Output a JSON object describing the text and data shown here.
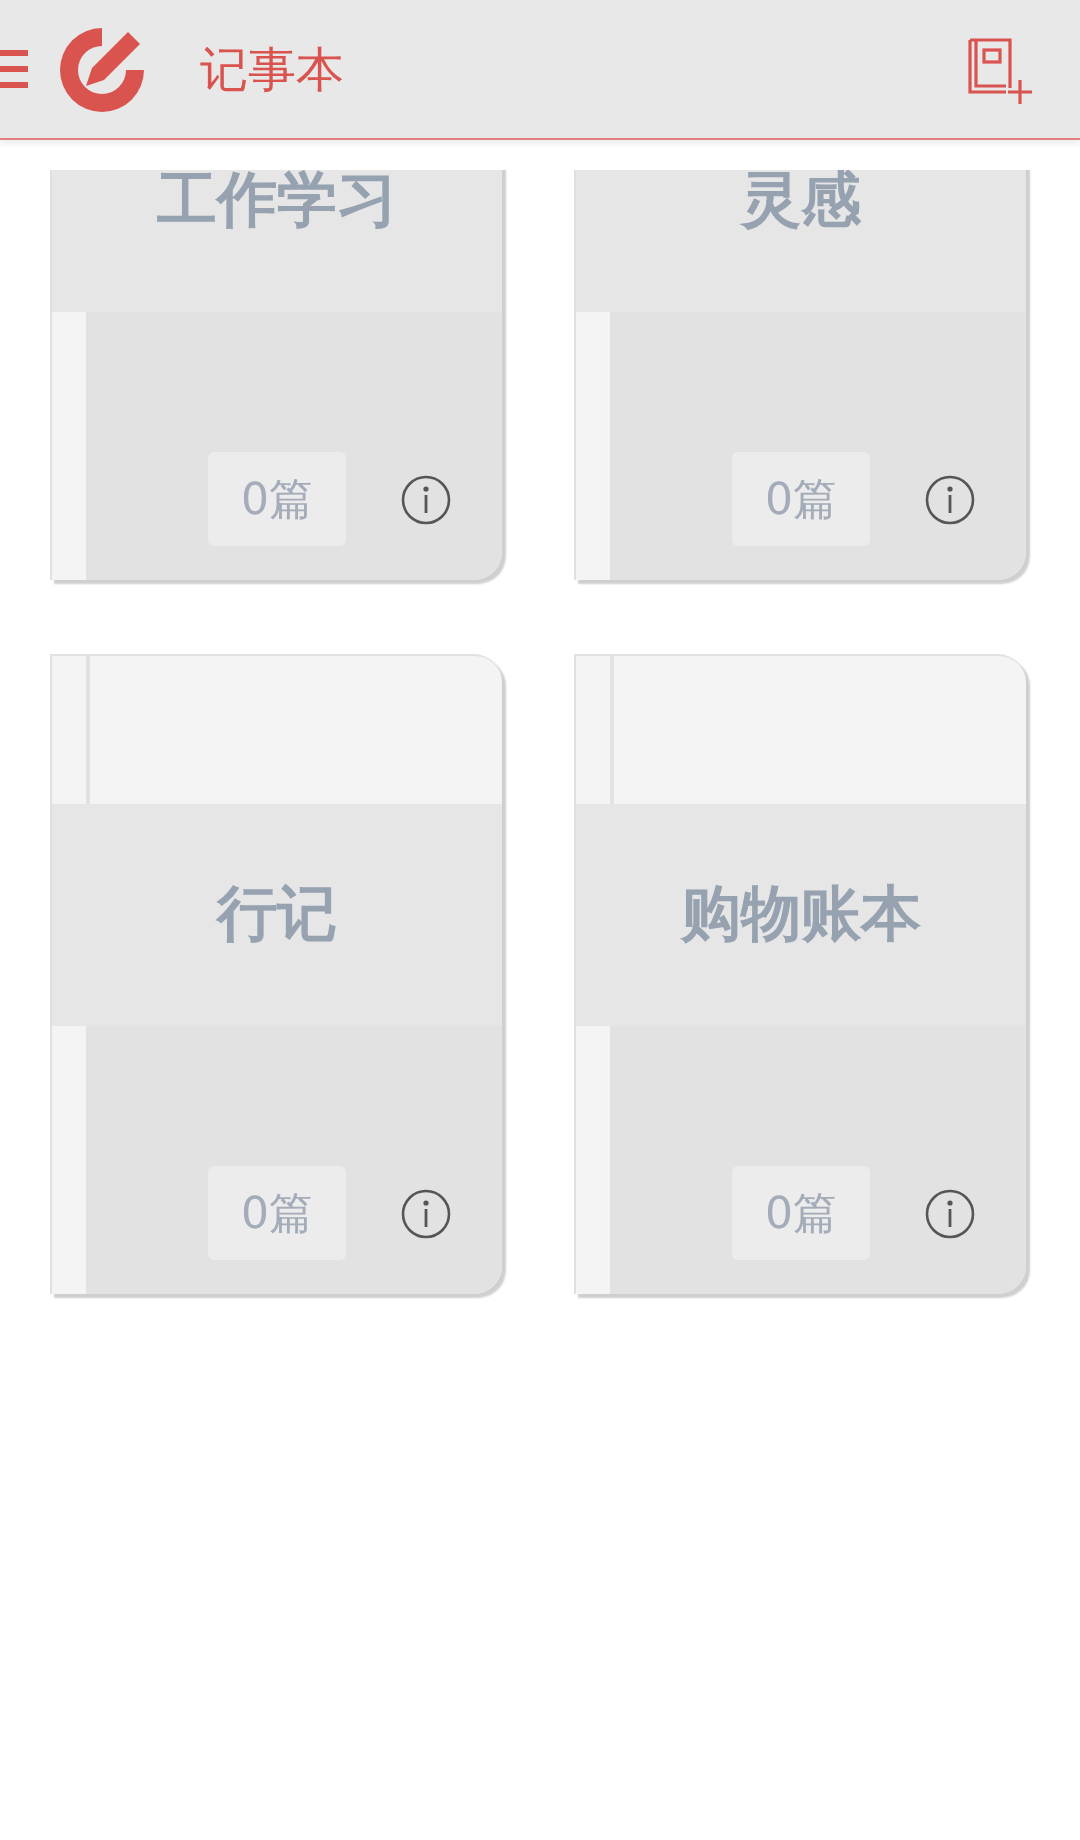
{
  "app_bar": {
    "title": "记事本"
  },
  "notebooks": [
    {
      "title": "工作学习",
      "count": "0篇"
    },
    {
      "title": "灵感",
      "count": "0篇"
    },
    {
      "title": "行记",
      "count": "0篇"
    },
    {
      "title": "购物账本",
      "count": "0篇"
    }
  ]
}
